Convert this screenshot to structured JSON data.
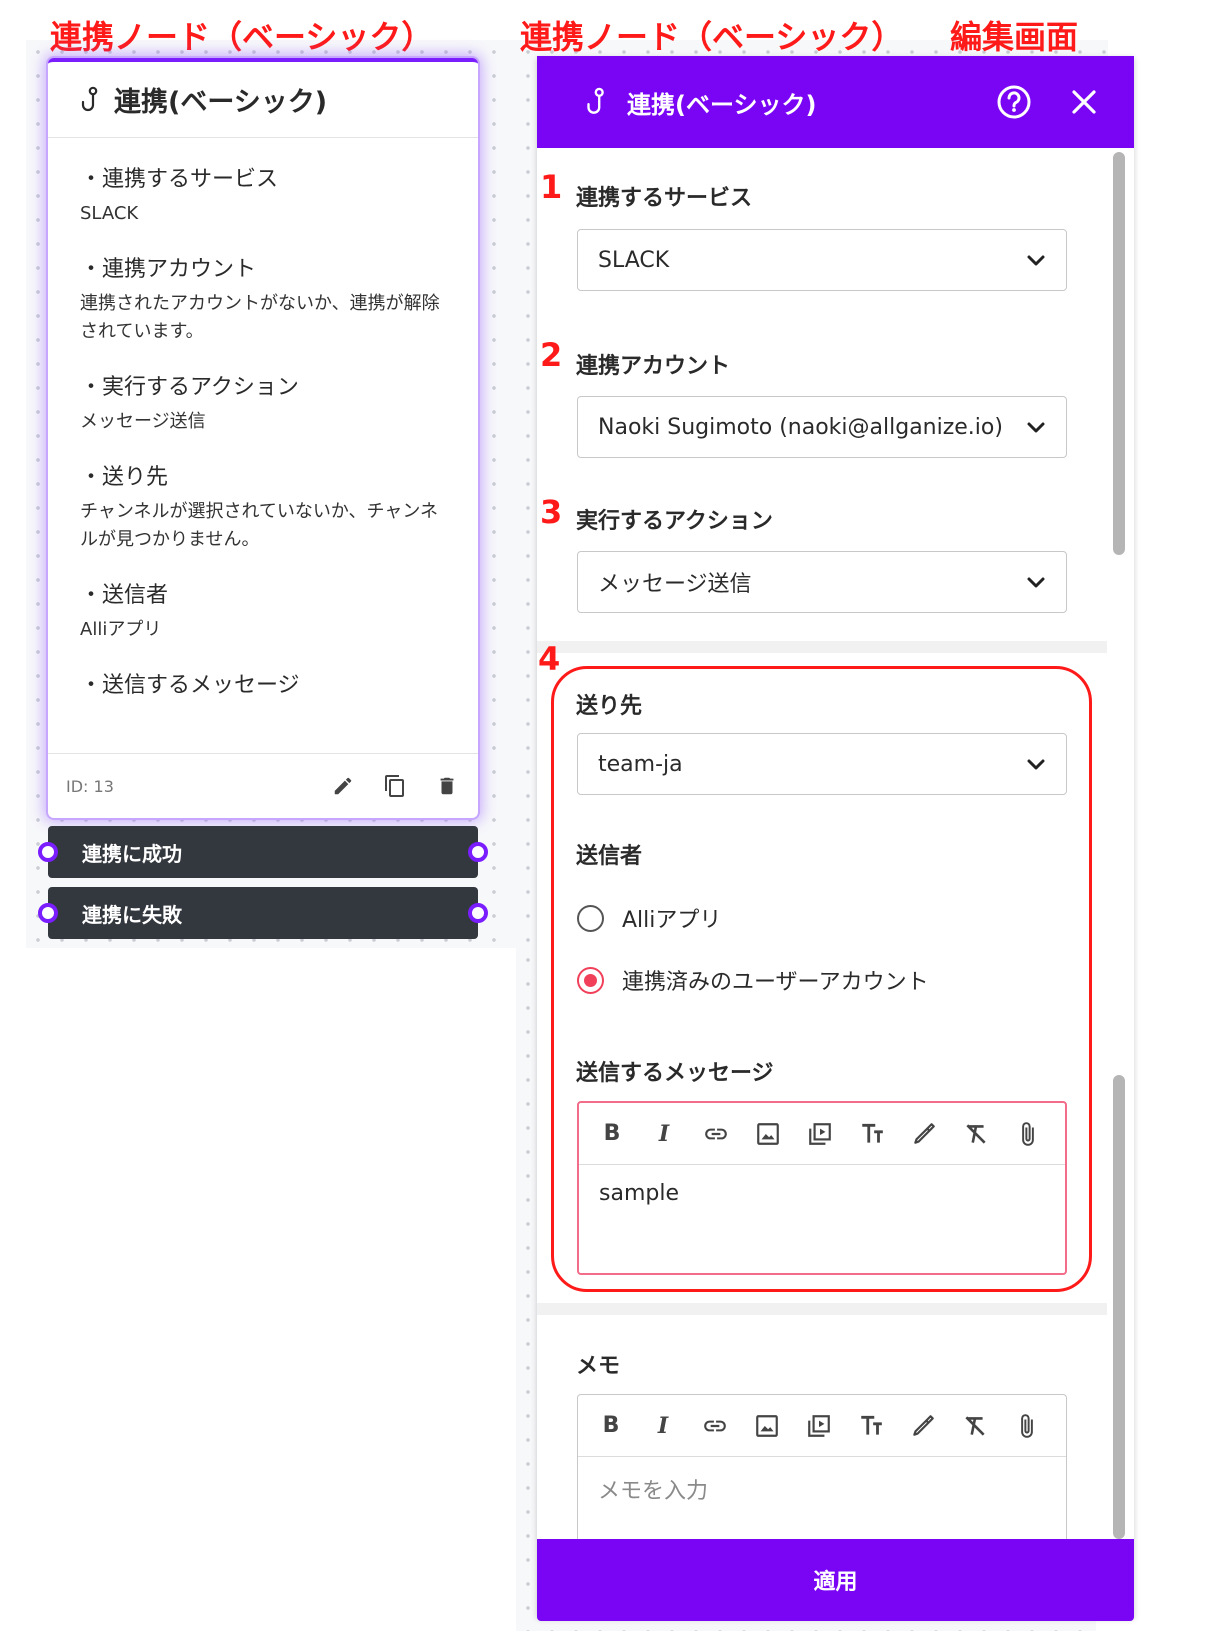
{
  "headings": {
    "left": "連携ノード（ベーシック）",
    "right": "連携ノード（ベーシック）",
    "right_suffix": "編集画面"
  },
  "node": {
    "title": "連携(ベーシック)",
    "fields": [
      {
        "label": "・連携するサービス",
        "value": "SLACK"
      },
      {
        "label": "・連携アカウント",
        "value": "連携されたアカウントがないか、連携が解除されています。"
      },
      {
        "label": "・実行するアクション",
        "value": "メッセージ送信"
      },
      {
        "label": "・送り先",
        "value": "チャンネルが選択されていないか、チャンネルが見つかりません。"
      },
      {
        "label": "・送信者",
        "value": "Alliアプリ"
      },
      {
        "label": "・送信するメッセージ",
        "value": ""
      }
    ],
    "id_label": "ID: 13",
    "outlets": [
      {
        "label": "連携に成功"
      },
      {
        "label": "連携に失敗"
      }
    ]
  },
  "panel": {
    "title": "連携(ベーシック)",
    "numbers": [
      "1",
      "2",
      "3",
      "4"
    ],
    "service": {
      "label": "連携するサービス",
      "value": "SLACK"
    },
    "account": {
      "label": "連携アカウント",
      "value": "Naoki Sugimoto (naoki@allganize.io)"
    },
    "action": {
      "label": "実行するアクション",
      "value": "メッセージ送信"
    },
    "destination": {
      "label": "送り先",
      "value": "team-ja"
    },
    "sender": {
      "label": "送信者",
      "options": [
        {
          "label": "Alliアプリ",
          "selected": false
        },
        {
          "label": "連携済みのユーザーアカウント",
          "selected": true
        }
      ]
    },
    "message": {
      "label": "送信するメッセージ",
      "value": "sample"
    },
    "memo": {
      "label": "メモ",
      "placeholder": "メモを入力"
    },
    "apply_label": "適用"
  },
  "colors": {
    "accent": "#7a05f5",
    "annotation": "#ff1a1a",
    "radio_selected": "#f0405a",
    "outlet_bg": "#33373e"
  },
  "icons": [
    "hook-icon",
    "help-icon",
    "close-icon",
    "pencil-icon",
    "copy-icon",
    "trash-icon",
    "chevron-down-icon",
    "bold-icon",
    "italic-icon",
    "link-icon",
    "image-icon",
    "video-icon",
    "text-size-icon",
    "color-picker-icon",
    "clear-format-icon",
    "attach-icon"
  ]
}
